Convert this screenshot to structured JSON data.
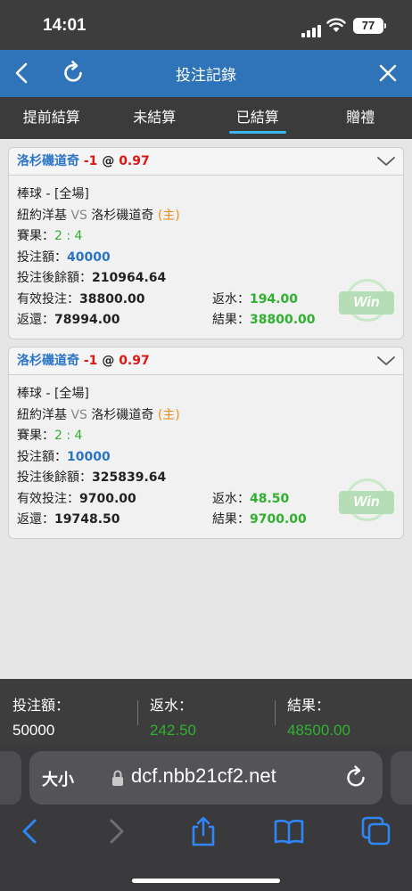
{
  "status_bar": {
    "time": "14:01",
    "battery": "77"
  },
  "navbar": {
    "title": "投注記錄"
  },
  "tabs": [
    {
      "label": "提前結算",
      "active": false
    },
    {
      "label": "未結算",
      "active": false
    },
    {
      "label": "已結算",
      "active": true
    },
    {
      "label": "贈禮",
      "active": false
    }
  ],
  "bets": [
    {
      "team": "洛杉磯道奇",
      "handicap": "-1",
      "at": "@",
      "odds": "0.97",
      "sport_line": "棒球 - [全場]",
      "home": "紐約洋基",
      "vs": "VS",
      "away": "洛杉磯道奇",
      "side": "(主)",
      "score_label": "賽果：",
      "score": "2 : 4",
      "stake_label": "投注額：",
      "stake": "40000",
      "balance_label": "投注後餘額：",
      "balance": "210964.64",
      "valid_label": "有效投注：",
      "valid": "38800.00",
      "rebate_label": "返水：",
      "rebate": "194.00",
      "return_label": "返還：",
      "return": "78994.00",
      "result_label": "結果：",
      "result": "38800.00",
      "badge": "Win"
    },
    {
      "team": "洛杉磯道奇",
      "handicap": "-1",
      "at": "@",
      "odds": "0.97",
      "sport_line": "棒球 - [全場]",
      "home": "紐約洋基",
      "vs": "VS",
      "away": "洛杉磯道奇",
      "side": "(主)",
      "score_label": "賽果：",
      "score": "2 : 4",
      "stake_label": "投注額：",
      "stake": "10000",
      "balance_label": "投注後餘額：",
      "balance": "325839.64",
      "valid_label": "有效投注：",
      "valid": "9700.00",
      "rebate_label": "返水：",
      "rebate": "48.50",
      "return_label": "返還：",
      "return": "19748.50",
      "result_label": "結果：",
      "result": "9700.00",
      "badge": "Win"
    }
  ],
  "summary": {
    "stake_label": "投注額：",
    "stake": "50000",
    "rebate_label": "返水：",
    "rebate": "242.50",
    "result_label": "結果：",
    "result": "48500.00"
  },
  "browser": {
    "text_size": "大小",
    "url": "dcf.nbb21cf2.net"
  },
  "colors": {
    "navbar": "#2f73b8",
    "tab_indicator": "#39b8f0",
    "positive": "#2fb12f",
    "link": "#2b74c6",
    "odds": "#e01616",
    "home_side": "#f08c18"
  }
}
